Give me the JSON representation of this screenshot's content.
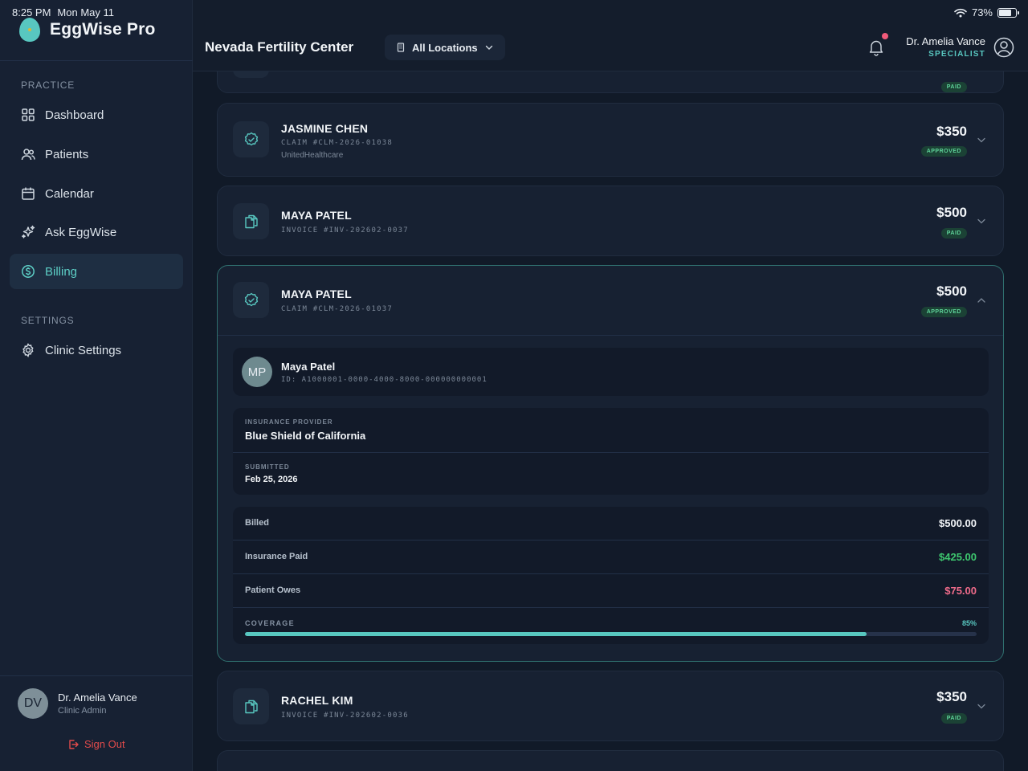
{
  "status_bar": {
    "time": "8:25 PM",
    "date": "Mon May 11",
    "battery": "73%",
    "battery_fraction": 0.73
  },
  "sidebar": {
    "brand": "EggWise Pro",
    "practice_label": "PRACTICE",
    "items": [
      {
        "label": "Dashboard",
        "icon": "grid-icon"
      },
      {
        "label": "Patients",
        "icon": "users-icon"
      },
      {
        "label": "Calendar",
        "icon": "calendar-icon"
      },
      {
        "label": "Ask EggWise",
        "icon": "sparkles-icon"
      },
      {
        "label": "Billing",
        "icon": "dollar-circle-icon",
        "active": true
      }
    ],
    "settings_label": "SETTINGS",
    "settings_items": [
      {
        "label": "Clinic Settings",
        "icon": "gear-icon"
      }
    ],
    "user": {
      "initials": "DV",
      "name": "Dr. Amelia Vance",
      "role": "Clinic Admin"
    },
    "sign_out": "Sign Out"
  },
  "header": {
    "clinic": "Nevada Fertility Center",
    "location": "All Locations",
    "user_name": "Dr. Amelia Vance",
    "user_role": "SPECIALIST"
  },
  "cards": [
    {
      "top_partial_badge": "PAID"
    },
    {
      "name": "JASMINE CHEN",
      "ref": "CLAIM #CLM-2026-01038",
      "insurer": "UnitedHealthcare",
      "amount": "$350",
      "status": "APPROVED"
    },
    {
      "name": "MAYA PATEL",
      "ref": "INVOICE #INV-202602-0037",
      "amount": "$500",
      "status": "PAID"
    },
    {
      "name": "MAYA PATEL",
      "ref": "CLAIM #CLM-2026-01037",
      "amount": "$500",
      "status": "APPROVED"
    },
    {
      "name": "RACHEL KIM",
      "ref": "INVOICE #INV-202602-0036",
      "amount": "$350",
      "status": "PAID"
    }
  ],
  "expanded": {
    "patient_initials": "MP",
    "patient_name": "Maya Patel",
    "patient_id": "ID: A1000001-0000-4000-8000-000000000001",
    "insurance_label": "INSURANCE PROVIDER",
    "insurance_value": "Blue Shield of California",
    "submitted_label": "SUBMITTED",
    "submitted_value": "Feb 25, 2026",
    "billed_label": "Billed",
    "billed_value": "$500.00",
    "ins_paid_label": "Insurance Paid",
    "ins_paid_value": "$425.00",
    "owes_label": "Patient Owes",
    "owes_value": "$75.00",
    "coverage_label": "COVERAGE",
    "coverage_pct": "85%",
    "coverage_fraction": 0.85
  },
  "colors": {
    "accent": "#58c7c0",
    "approved": "#5fd49a",
    "green": "#3ec76f",
    "pink": "#ef6b8a",
    "danger": "#e24b4b"
  }
}
